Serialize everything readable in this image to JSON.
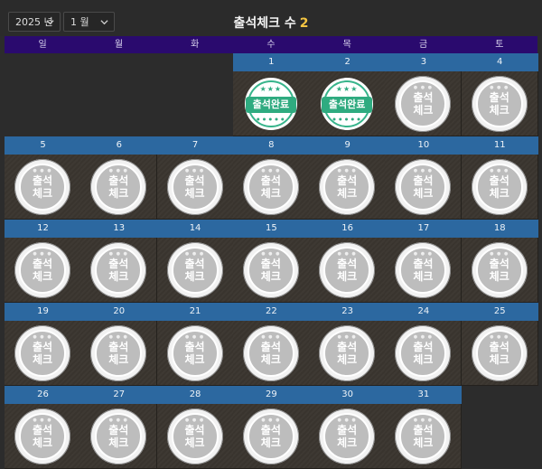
{
  "header": {
    "year_label": "2025 년",
    "month_label": "1 월",
    "title_prefix": "출석체크 수",
    "count": "2"
  },
  "weekdays": [
    "일",
    "월",
    "화",
    "수",
    "목",
    "금",
    "토"
  ],
  "stamps": {
    "done_text": "출석완료",
    "pending_line1": "출석",
    "pending_line2": "체크"
  },
  "calendar": {
    "first_weekday_index": 3,
    "days": [
      "1",
      "2",
      "3",
      "4",
      "5",
      "6",
      "7",
      "8",
      "9",
      "10",
      "11",
      "12",
      "13",
      "14",
      "15",
      "16",
      "17",
      "18",
      "19",
      "20",
      "21",
      "22",
      "23",
      "24",
      "25",
      "26",
      "27",
      "28",
      "29",
      "30",
      "31"
    ],
    "attended_days": [
      "1",
      "2"
    ]
  },
  "colors": {
    "weekday_bar": "#2a0a6e",
    "day_number_bar": "#2c68a0",
    "count_accent": "#f4c542",
    "done_stamp": "#2fab80"
  }
}
